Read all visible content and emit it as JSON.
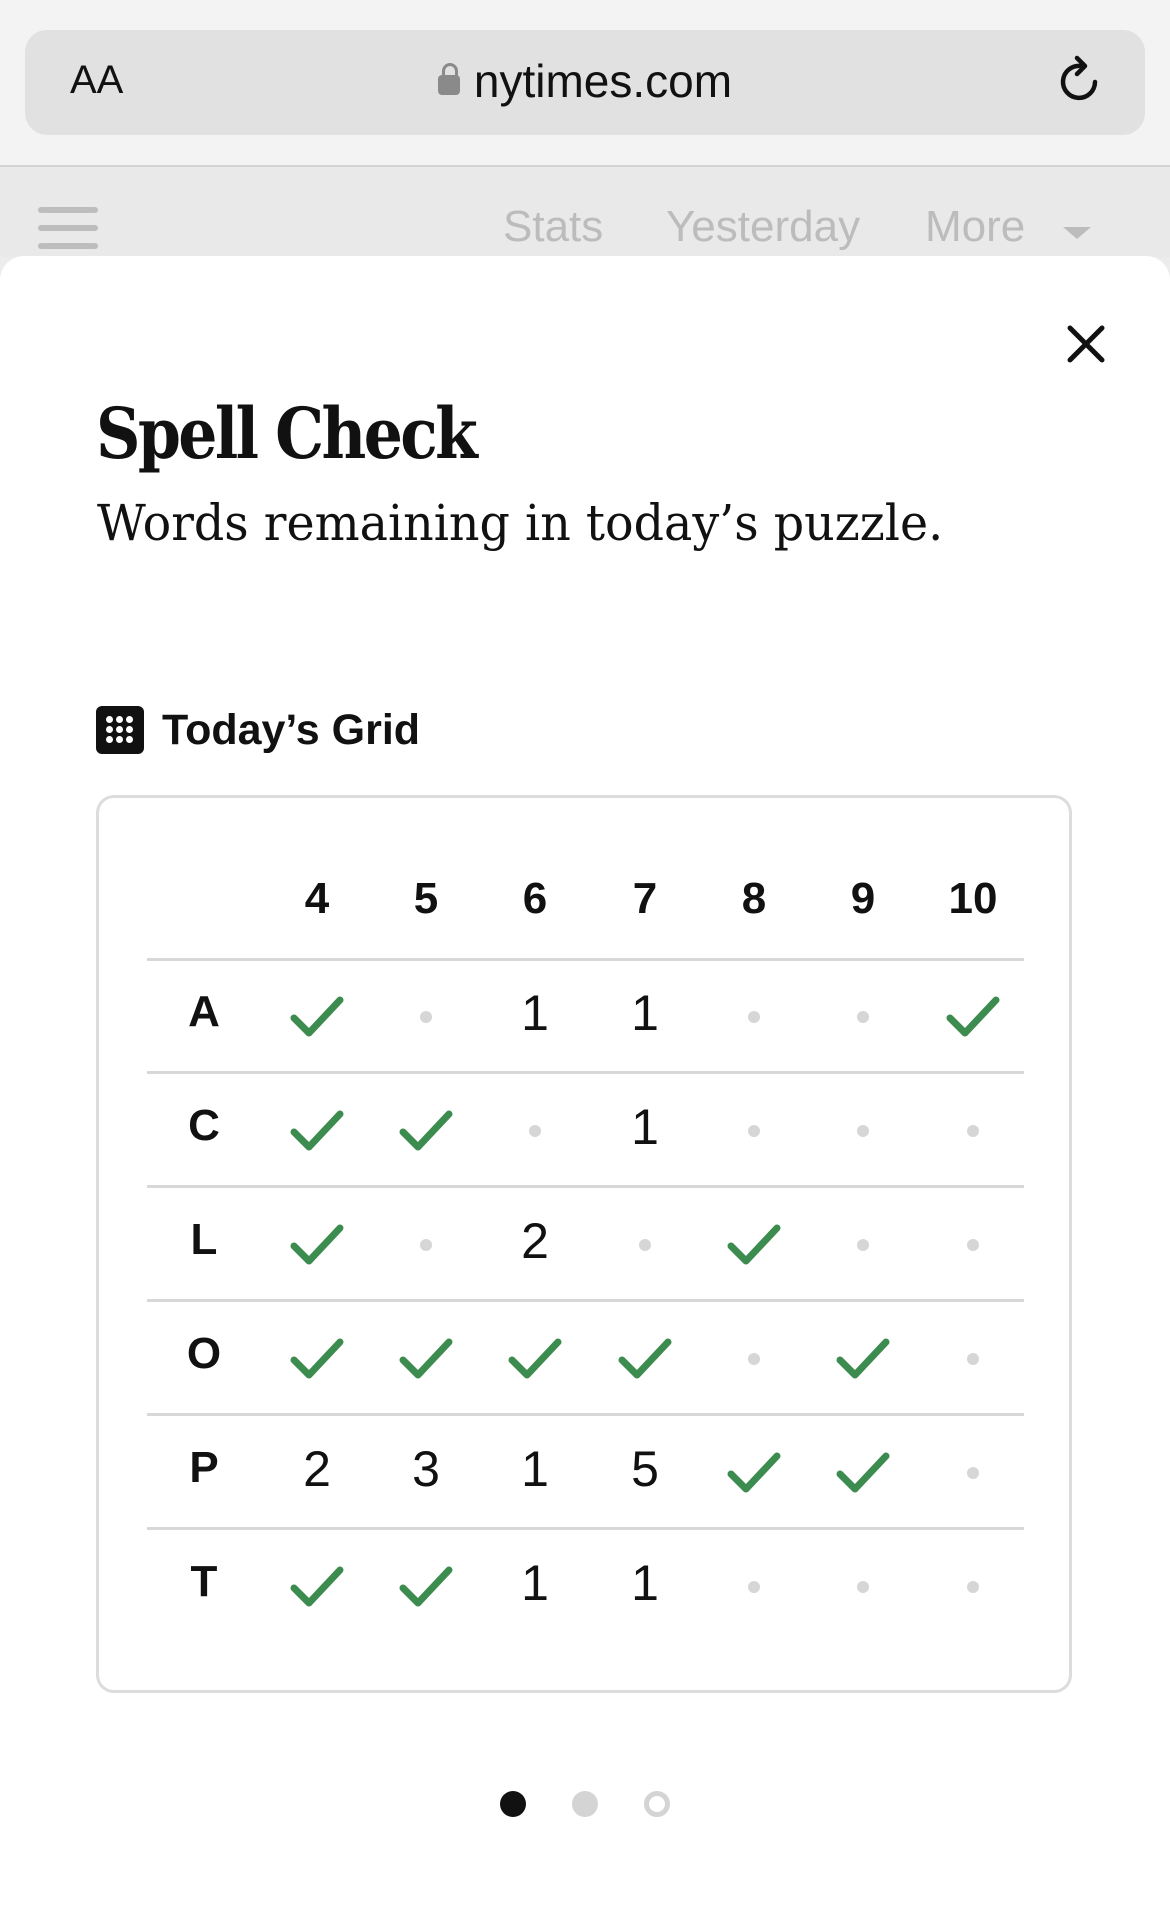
{
  "browser": {
    "text_size_label": "AA",
    "url": "nytimes.com"
  },
  "page_nav": {
    "links": [
      "Stats",
      "Yesterday",
      "More"
    ]
  },
  "modal": {
    "title": "Spell Check",
    "subtitle": "Words remaining in today’s puzzle.",
    "grid_heading": "Today’s Grid",
    "grid": {
      "columns": [
        "4",
        "5",
        "6",
        "7",
        "8",
        "9",
        "10"
      ],
      "rows": [
        {
          "letter": "A",
          "cells": [
            "check",
            "none",
            "1",
            "1",
            "none",
            "none",
            "check"
          ]
        },
        {
          "letter": "C",
          "cells": [
            "check",
            "check",
            "none",
            "1",
            "none",
            "none",
            "none"
          ]
        },
        {
          "letter": "L",
          "cells": [
            "check",
            "none",
            "2",
            "none",
            "check",
            "none",
            "none"
          ]
        },
        {
          "letter": "O",
          "cells": [
            "check",
            "check",
            "check",
            "check",
            "none",
            "check",
            "none"
          ]
        },
        {
          "letter": "P",
          "cells": [
            "2",
            "3",
            "1",
            "5",
            "check",
            "check",
            "none"
          ]
        },
        {
          "letter": "T",
          "cells": [
            "check",
            "check",
            "1",
            "1",
            "none",
            "none",
            "none"
          ]
        }
      ]
    },
    "pager": {
      "total": 3,
      "current": 1
    }
  },
  "colors": {
    "check": "#3d8c4f",
    "empty_dot": "#d6d6d6",
    "pager_active": "#111111",
    "pager_inactive": "#d4d4d4"
  },
  "icons": {
    "lock": "lock-icon",
    "reload": "reload-icon",
    "menu": "hamburger-icon",
    "close": "close-icon",
    "grid": "grid-icon",
    "check": "checkmark-icon",
    "dropdown": "caret-down-icon"
  }
}
